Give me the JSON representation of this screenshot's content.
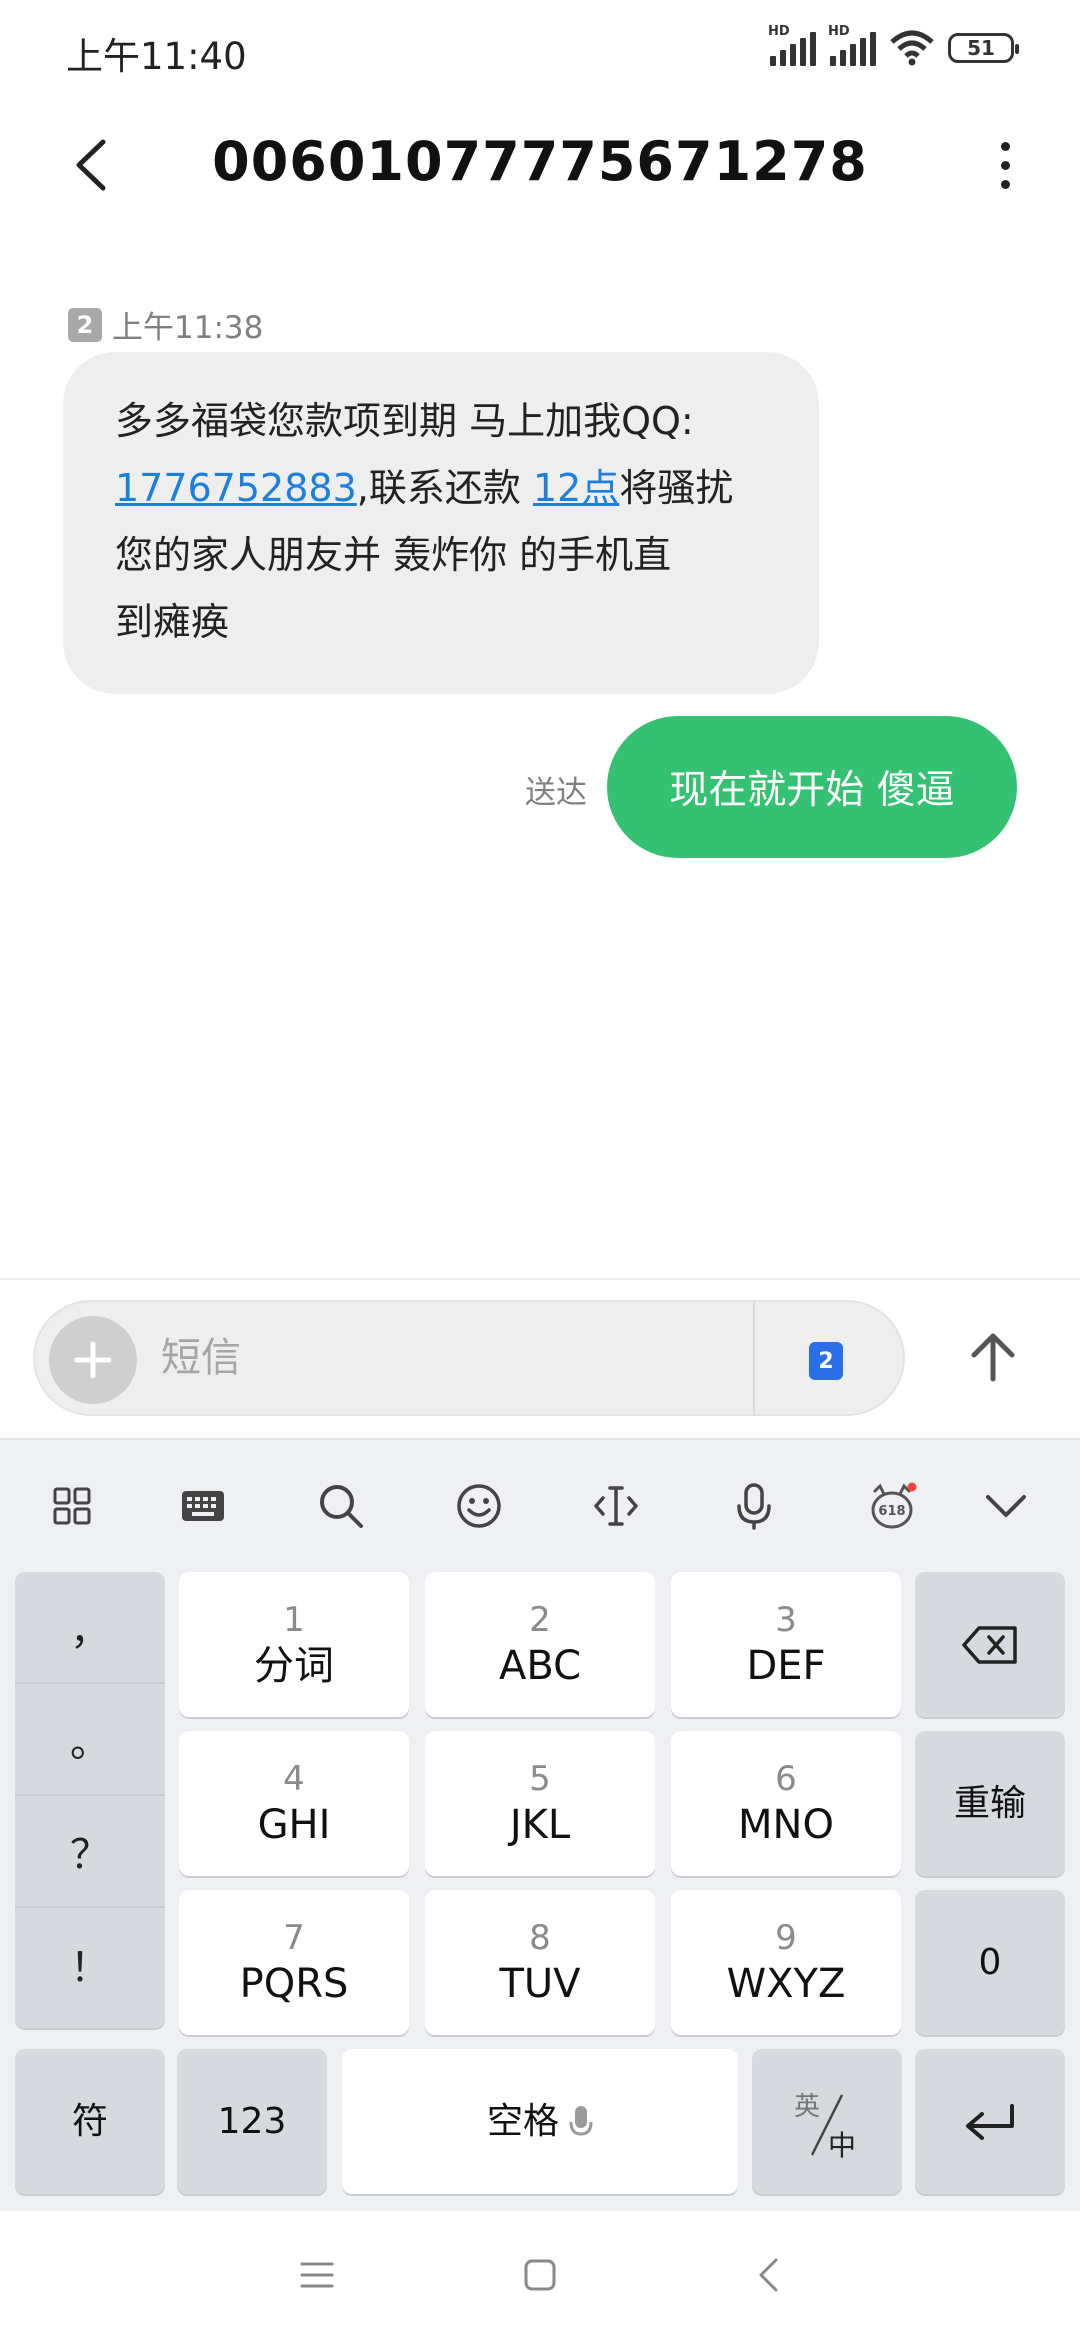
{
  "status_bar": {
    "time": "上午11:40",
    "battery": "51",
    "signal_label": "HD"
  },
  "header": {
    "title": "00601077775671278"
  },
  "conversation": {
    "incoming": {
      "sim_badge": "2",
      "time": "上午11:38",
      "text_part1": "多多福袋您款项到期 马上加我QQ:",
      "link_qq": "1776752883",
      "text_part2": ",联系还款 ",
      "link_time": "12点",
      "text_part3": "将骚扰",
      "line3": "您的家人朋友并 轰炸你 的手机直",
      "line4": "到瘫痪"
    },
    "outgoing": {
      "status": "送达",
      "text": "现在就开始 傻逼"
    }
  },
  "composer": {
    "placeholder": "短信",
    "sim_label": "2"
  },
  "keyboard": {
    "side_keys": [
      "，",
      "。",
      "？",
      "！"
    ],
    "keys": [
      {
        "num": "1",
        "letters": "分词"
      },
      {
        "num": "2",
        "letters": "ABC"
      },
      {
        "num": "3",
        "letters": "DEF"
      },
      {
        "num": "4",
        "letters": "GHI"
      },
      {
        "num": "5",
        "letters": "JKL"
      },
      {
        "num": "6",
        "letters": "MNO"
      },
      {
        "num": "7",
        "letters": "PQRS"
      },
      {
        "num": "8",
        "letters": "TUV"
      },
      {
        "num": "9",
        "letters": "WXYZ"
      }
    ],
    "reenter_label": "重输",
    "zero_label": "0",
    "symbols_label": "符",
    "num_label": "123",
    "space_label": "空格",
    "lang_en": "英",
    "lang_zh": "中",
    "toolbar_badge": "618"
  },
  "colors": {
    "accent_green": "#34c172",
    "link_blue": "#1a7fe0",
    "sim_blue": "#2a6ee8"
  }
}
